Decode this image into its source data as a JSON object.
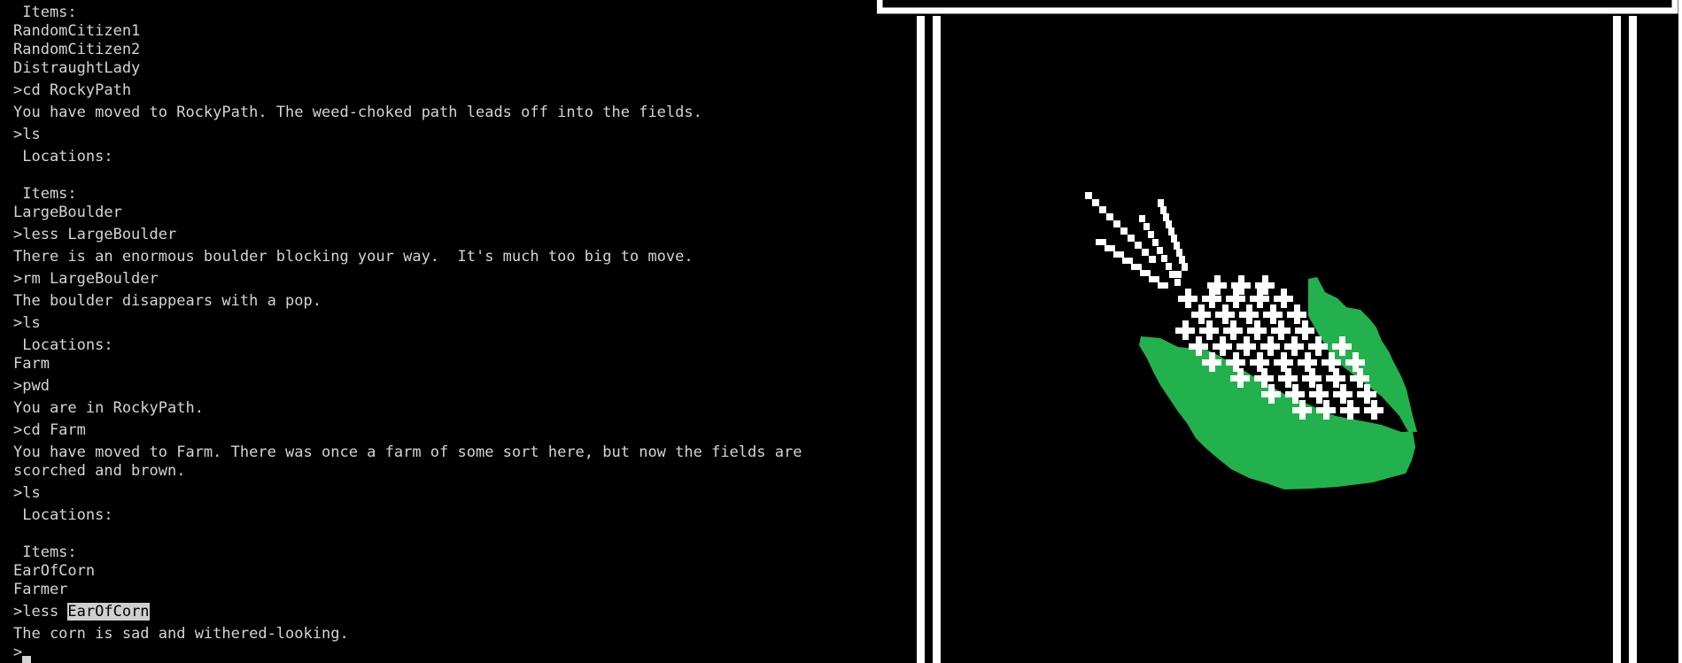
{
  "terminal": {
    "lines": [
      " Items:",
      "RandomCitizen1",
      "RandomCitizen2",
      "DistraughtLady",
      ">cd RockyPath",
      "You have moved to RockyPath. The weed-choked path leads off into the fields.",
      ">ls",
      " Locations:",
      "",
      " Items:",
      "LargeBoulder",
      ">less LargeBoulder",
      "There is an enormous boulder blocking your way.  It's much too big to move.",
      ">rm LargeBoulder",
      "The boulder disappears with a pop.",
      ">ls",
      " Locations:",
      "Farm",
      ">pwd",
      "You are in RockyPath.",
      ">cd Farm",
      "You have moved to Farm. There was once a farm of some sort here, but now the fields are",
      "scorched and brown.",
      ">ls",
      " Locations:",
      "",
      " Items:",
      "EarOfCorn",
      "Farmer"
    ],
    "last_command_prefix": ">less ",
    "last_command_arg": "EarOfCorn",
    "last_output": "The corn is sad and withered-looking.",
    "prompt": ">"
  },
  "art": {
    "subject": "ear-of-corn",
    "husk_color": "#22b14c",
    "frame_color": "#ffffff",
    "background_color": "#000000"
  }
}
